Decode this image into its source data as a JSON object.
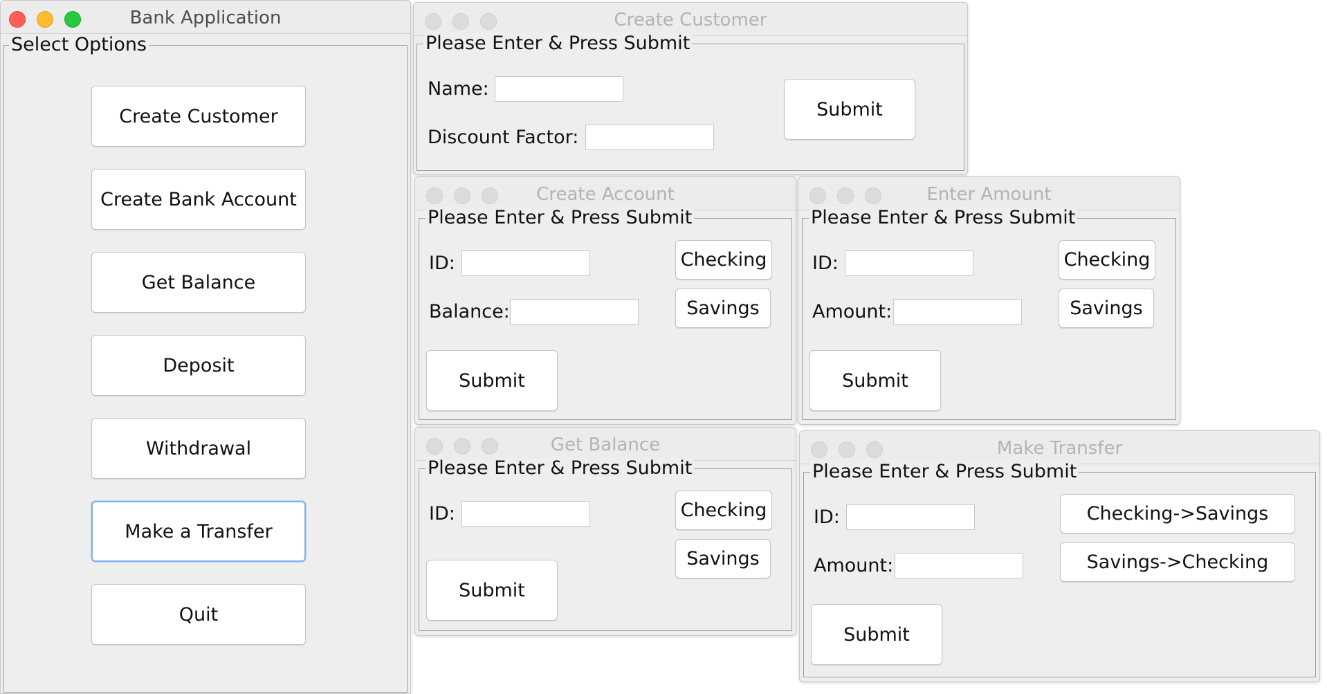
{
  "bank_app": {
    "title": "Bank Application",
    "group_label": "Select Options",
    "buttons": [
      "Create Customer",
      "Create Bank Account",
      "Get Balance",
      "Deposit",
      "Withdrawal",
      "Make a Transfer",
      "Quit"
    ],
    "focused_button": "Make a Transfer"
  },
  "create_customer": {
    "title": "Create Customer",
    "group_label": "Please Enter & Press Submit",
    "name_label": "Name:",
    "name_value": "",
    "discount_label": "Discount Factor:",
    "discount_value": "",
    "submit": "Submit"
  },
  "create_account": {
    "title": "Create Account",
    "group_label": "Please Enter & Press Submit",
    "id_label": "ID:",
    "id_value": "",
    "balance_label": "Balance:",
    "balance_value": "",
    "checking": "Checking",
    "savings": "Savings",
    "submit": "Submit"
  },
  "enter_amount": {
    "title": "Enter Amount",
    "group_label": "Please Enter & Press Submit",
    "id_label": "ID:",
    "id_value": "",
    "amount_label": "Amount:",
    "amount_value": "",
    "checking": "Checking",
    "savings": "Savings",
    "submit": "Submit"
  },
  "get_balance": {
    "title": "Get Balance",
    "group_label": "Please Enter & Press Submit",
    "id_label": "ID:",
    "id_value": "",
    "checking": "Checking",
    "savings": "Savings",
    "submit": "Submit"
  },
  "make_transfer": {
    "title": "Make Transfer",
    "group_label": "Please Enter & Press Submit",
    "id_label": "ID:",
    "id_value": "",
    "amount_label": "Amount:",
    "amount_value": "",
    "checking_to_savings": "Checking->Savings",
    "savings_to_checking": "Savings->Checking",
    "submit": "Submit"
  },
  "colors": {
    "window_bg": "#eeeeee",
    "close": "#ff5f57",
    "minimize": "#febc2e",
    "zoom": "#28c840",
    "focus_ring": "#7fb1ec"
  }
}
